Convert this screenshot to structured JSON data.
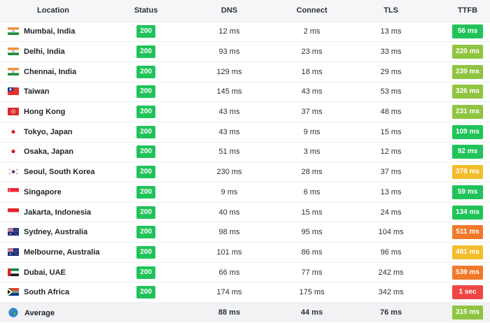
{
  "headers": {
    "location": "Location",
    "status": "Status",
    "dns": "DNS",
    "connect": "Connect",
    "tls": "TLS",
    "ttfb": "TTFB"
  },
  "colors": {
    "status_ok": "#20c35a",
    "ttfb_fast": "#20c35a",
    "ttfb_good": "#8fc441",
    "ttfb_moderate": "#f3bc2b",
    "ttfb_slow": "#f2782a",
    "ttfb_very_slow": "#ef4545"
  },
  "rows": [
    {
      "flag": "india-flag-icon",
      "location": "Mumbai, India",
      "status": "200",
      "dns": "12 ms",
      "connect": "2 ms",
      "tls": "13 ms",
      "ttfb": "56 ms",
      "ttfb_color": "#20c35a"
    },
    {
      "flag": "india-flag-icon",
      "location": "Delhi, India",
      "status": "200",
      "dns": "93 ms",
      "connect": "23 ms",
      "tls": "33 ms",
      "ttfb": "220 ms",
      "ttfb_color": "#8fc441"
    },
    {
      "flag": "india-flag-icon",
      "location": "Chennai, India",
      "status": "200",
      "dns": "129 ms",
      "connect": "18 ms",
      "tls": "29 ms",
      "ttfb": "239 ms",
      "ttfb_color": "#8fc441"
    },
    {
      "flag": "taiwan-flag-icon",
      "location": "Taiwan",
      "status": "200",
      "dns": "145 ms",
      "connect": "43 ms",
      "tls": "53 ms",
      "ttfb": "326 ms",
      "ttfb_color": "#8fc441"
    },
    {
      "flag": "hong-kong-flag-icon",
      "location": "Hong Kong",
      "status": "200",
      "dns": "43 ms",
      "connect": "37 ms",
      "tls": "48 ms",
      "ttfb": "231 ms",
      "ttfb_color": "#8fc441"
    },
    {
      "flag": "japan-flag-icon",
      "location": "Tokyo, Japan",
      "status": "200",
      "dns": "43 ms",
      "connect": "9 ms",
      "tls": "15 ms",
      "ttfb": "109 ms",
      "ttfb_color": "#20c35a"
    },
    {
      "flag": "japan-flag-icon",
      "location": "Osaka, Japan",
      "status": "200",
      "dns": "51 ms",
      "connect": "3 ms",
      "tls": "12 ms",
      "ttfb": "92 ms",
      "ttfb_color": "#20c35a"
    },
    {
      "flag": "south-korea-flag-icon",
      "location": "Seoul, South Korea",
      "status": "200",
      "dns": "230 ms",
      "connect": "28 ms",
      "tls": "37 ms",
      "ttfb": "378 ms",
      "ttfb_color": "#f3bc2b"
    },
    {
      "flag": "singapore-flag-icon",
      "location": "Singapore",
      "status": "200",
      "dns": "9 ms",
      "connect": "6 ms",
      "tls": "13 ms",
      "ttfb": "59 ms",
      "ttfb_color": "#20c35a"
    },
    {
      "flag": "indonesia-flag-icon",
      "location": "Jakarta, Indonesia",
      "status": "200",
      "dns": "40 ms",
      "connect": "15 ms",
      "tls": "24 ms",
      "ttfb": "134 ms",
      "ttfb_color": "#20c35a"
    },
    {
      "flag": "australia-flag-icon",
      "location": "Sydney, Australia",
      "status": "200",
      "dns": "98 ms",
      "connect": "95 ms",
      "tls": "104 ms",
      "ttfb": "511 ms",
      "ttfb_color": "#f2782a"
    },
    {
      "flag": "australia-flag-icon",
      "location": "Melbourne, Australia",
      "status": "200",
      "dns": "101 ms",
      "connect": "86 ms",
      "tls": "96 ms",
      "ttfb": "481 ms",
      "ttfb_color": "#f3bc2b"
    },
    {
      "flag": "uae-flag-icon",
      "location": "Dubai, UAE",
      "status": "200",
      "dns": "66 ms",
      "connect": "77 ms",
      "tls": "242 ms",
      "ttfb": "539 ms",
      "ttfb_color": "#f2782a"
    },
    {
      "flag": "south-africa-flag-icon",
      "location": "South Africa",
      "status": "200",
      "dns": "174 ms",
      "connect": "175 ms",
      "tls": "342 ms",
      "ttfb": "1 sec",
      "ttfb_color": "#ef4545"
    }
  ],
  "average": {
    "icon": "globe-icon",
    "label": "Average",
    "dns": "88 ms",
    "connect": "44 ms",
    "tls": "76 ms",
    "ttfb": "315 ms",
    "ttfb_color": "#8fc441"
  }
}
